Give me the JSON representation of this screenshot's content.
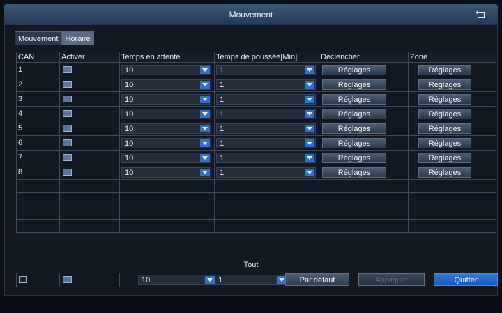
{
  "window": {
    "title": "Mouvement",
    "back_icon": "return-icon"
  },
  "tabs": [
    {
      "label": "Mouvement",
      "active": true
    },
    {
      "label": "Horaire",
      "active": false
    }
  ],
  "columns": [
    "CAN",
    "Activer",
    "Temps en attente",
    "Temps de poussée[Min]",
    "Déclencher",
    "Zone"
  ],
  "rows": [
    {
      "channel": "1",
      "enabled": true,
      "wait": "10",
      "push": "1",
      "trigger": "Réglages",
      "zone": "Réglages"
    },
    {
      "channel": "2",
      "enabled": true,
      "wait": "10",
      "push": "1",
      "trigger": "Réglages",
      "zone": "Réglages"
    },
    {
      "channel": "3",
      "enabled": true,
      "wait": "10",
      "push": "1",
      "trigger": "Réglages",
      "zone": "Réglages"
    },
    {
      "channel": "4",
      "enabled": true,
      "wait": "10",
      "push": "1",
      "trigger": "Réglages",
      "zone": "Réglages"
    },
    {
      "channel": "5",
      "enabled": true,
      "wait": "10",
      "push": "1",
      "trigger": "Réglages",
      "zone": "Réglages"
    },
    {
      "channel": "6",
      "enabled": true,
      "wait": "10",
      "push": "1",
      "trigger": "Réglages",
      "zone": "Réglages"
    },
    {
      "channel": "7",
      "enabled": true,
      "wait": "10",
      "push": "1",
      "trigger": "Réglages",
      "zone": "Réglages"
    },
    {
      "channel": "8",
      "enabled": true,
      "wait": "10",
      "push": "1",
      "trigger": "Réglages",
      "zone": "Réglages"
    }
  ],
  "all": {
    "label": "Tout",
    "wait": "10",
    "push": "1"
  },
  "footer": {
    "default_label": "Par défaut",
    "apply_label": "Appliquer",
    "quit_label": "Quitter"
  },
  "colors": {
    "accent": "#2f6fd0",
    "title_bar": "#2d4766",
    "background": "#121922"
  }
}
